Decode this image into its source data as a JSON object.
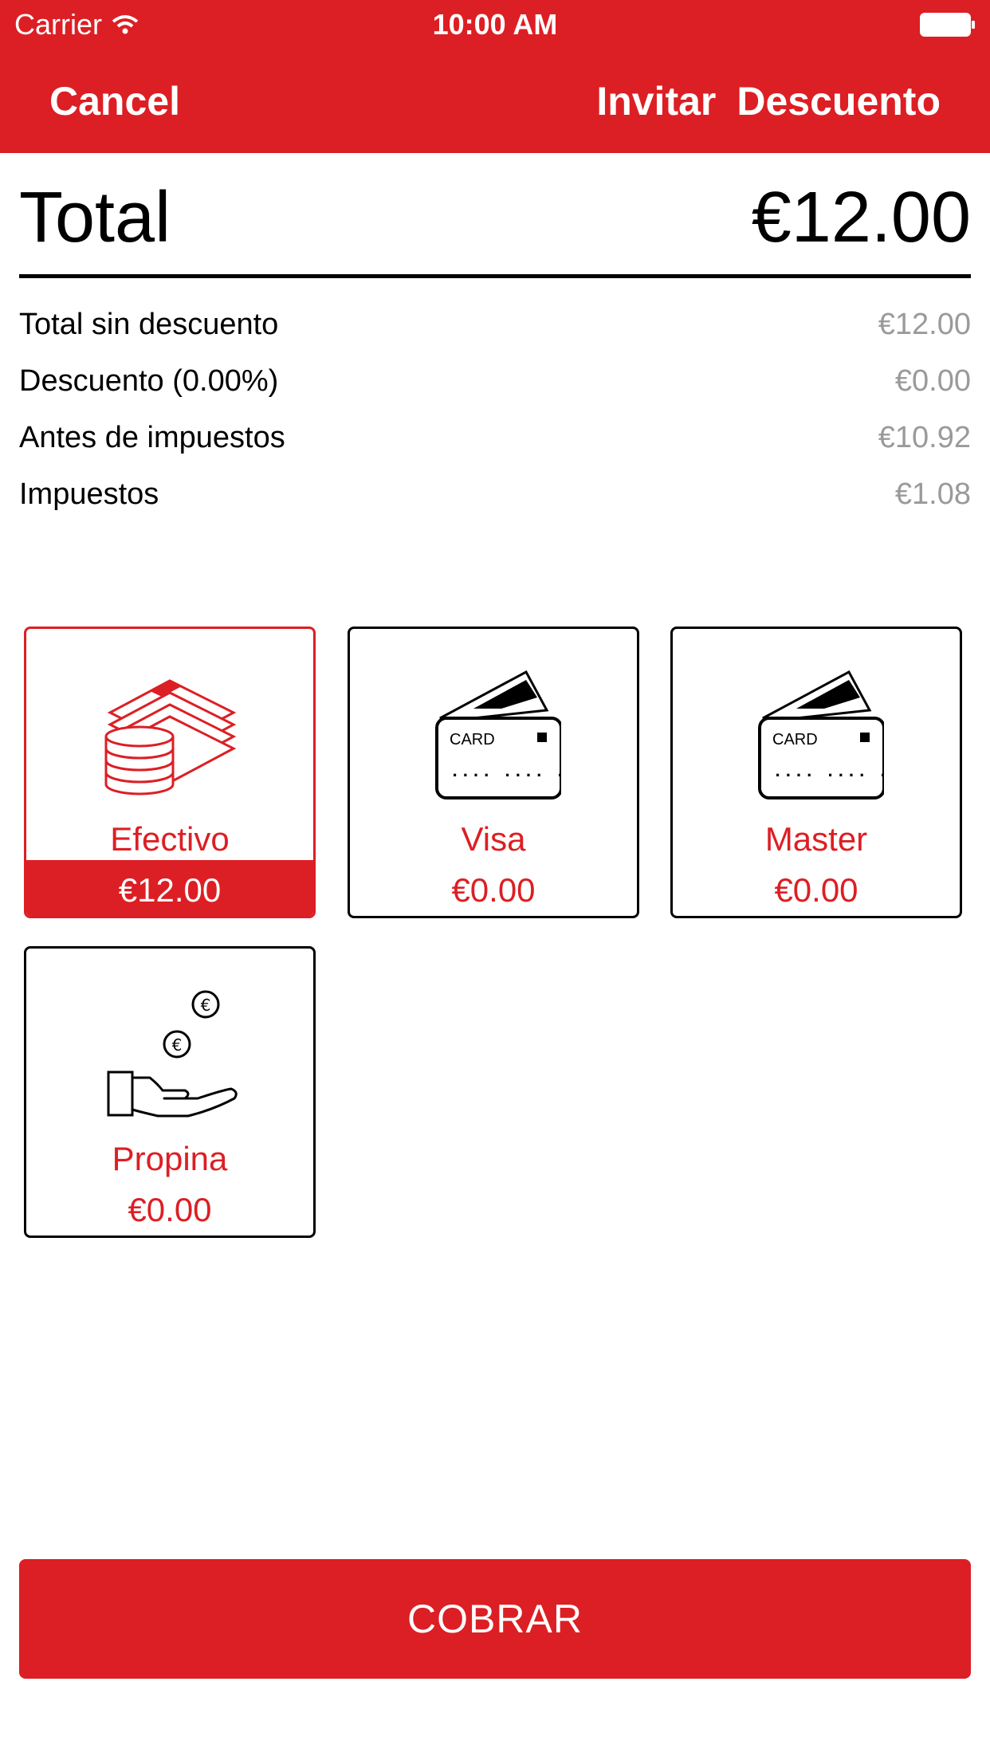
{
  "status_bar": {
    "carrier": "Carrier",
    "time": "10:00 AM"
  },
  "nav": {
    "cancel": "Cancel",
    "invitar": "Invitar",
    "descuento": "Descuento"
  },
  "total": {
    "label": "Total",
    "value": "€12.00"
  },
  "breakdown": [
    {
      "label": "Total sin descuento",
      "value": "€12.00"
    },
    {
      "label": "Descuento (0.00%)",
      "value": "€0.00"
    },
    {
      "label": "Antes de impuestos",
      "value": "€10.92"
    },
    {
      "label": "Impuestos",
      "value": "€1.08"
    }
  ],
  "payment_methods": [
    {
      "name": "Efectivo",
      "amount": "€12.00",
      "icon": "cash-coins-icon",
      "selected": true
    },
    {
      "name": "Visa",
      "amount": "€0.00",
      "icon": "credit-card-icon",
      "card_text": "CARD",
      "selected": false
    },
    {
      "name": "Master",
      "amount": "€0.00",
      "icon": "credit-card-icon",
      "card_text": "CARD",
      "selected": false
    },
    {
      "name": "Propina",
      "amount": "€0.00",
      "icon": "tip-hand-coins-icon",
      "coin_symbol": "€",
      "selected": false
    }
  ],
  "action": {
    "label": "COBRAR"
  },
  "colors": {
    "accent": "#dc1f24",
    "muted": "#9a9a9a"
  }
}
